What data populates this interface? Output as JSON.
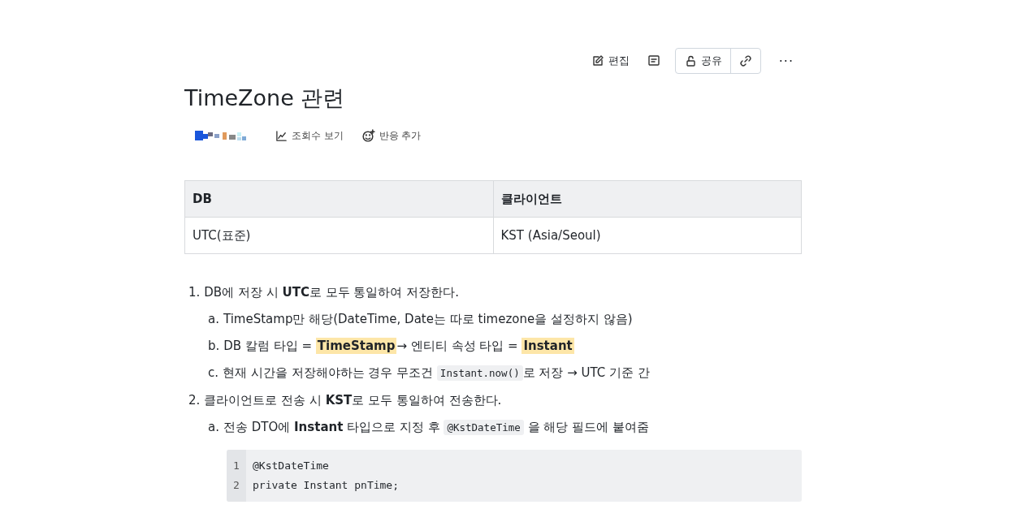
{
  "toolbar": {
    "edit": "편집",
    "share": "공유",
    "more": "···"
  },
  "title": "TimeZone 관련",
  "meta": {
    "views": "조회수 보기",
    "reaction": "반응 추가"
  },
  "table": {
    "columns": [
      "DB",
      "클라이언트"
    ],
    "rows": [
      [
        "UTC(표준)",
        "KST (Asia/Seoul)"
      ]
    ]
  },
  "list": [
    {
      "marker": "1.",
      "segments": [
        {
          "kind": "text",
          "text": "DB에 저장 시 **UTC**로 모두 통일하여 저장한다."
        }
      ],
      "children": [
        {
          "marker": "a.",
          "segments": [
            {
              "kind": "text",
              "text": "TimeStamp만 해당(DateTime, Date는 따로 timezone을 설정하지 않음)"
            }
          ]
        },
        {
          "marker": "b.",
          "segments": [
            {
              "kind": "text",
              "text": "DB 칼럼 타입 = "
            },
            {
              "kind": "highlight",
              "text": "TimeStamp"
            },
            {
              "kind": "text",
              "text": "→ 엔티티 속성 타입 = "
            },
            {
              "kind": "highlight",
              "text": "Instant"
            }
          ]
        },
        {
          "marker": "c.",
          "segments": [
            {
              "kind": "text",
              "text": "현재 시간을 저장해야하는 경우 무조건 "
            },
            {
              "kind": "code",
              "text": "Instant.now()"
            },
            {
              "kind": "text",
              "text": "로 저장 → UTC 기준 간"
            }
          ]
        }
      ]
    },
    {
      "marker": "2.",
      "segments": [
        {
          "kind": "text",
          "text": "클라이언트로 전송 시 **KST**로 모두 통일하여 전송한다."
        }
      ],
      "children": [
        {
          "marker": "a.",
          "segments": [
            {
              "kind": "text",
              "text": "전송 DTO에 **Instant** 타입으로 지정 후 "
            },
            {
              "kind": "code",
              "text": "@KstDateTime"
            },
            {
              "kind": "text",
              "text": " 을 해당 필드에 붙여줌"
            }
          ]
        }
      ],
      "code": [
        {
          "number": "1",
          "text": "@KstDateTime"
        },
        {
          "number": "2",
          "text": "private Instant pnTime;"
        }
      ]
    }
  ]
}
